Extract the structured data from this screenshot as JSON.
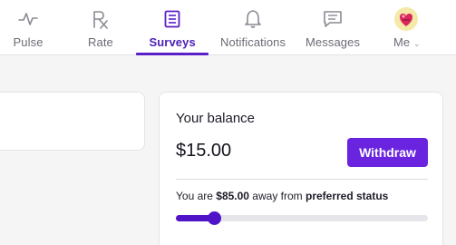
{
  "nav": {
    "items": [
      {
        "label": "Pulse",
        "icon": "pulse-icon"
      },
      {
        "label": "Rate",
        "icon": "rx-icon"
      },
      {
        "label": "Surveys",
        "icon": "survey-list-icon",
        "active": true
      },
      {
        "label": "Notifications",
        "icon": "bell-icon"
      },
      {
        "label": "Messages",
        "icon": "message-icon"
      },
      {
        "label": "Me",
        "icon": "avatar"
      }
    ],
    "active_color": "#5a1fc9"
  },
  "balance": {
    "title": "Your balance",
    "amount": "$15.00",
    "withdraw_label": "Withdraw",
    "status_prefix": "You are ",
    "status_amount": "$85.00",
    "status_middle": " away from ",
    "status_target": "preferred status",
    "progress": 0.15
  },
  "colors": {
    "accent": "#6a24e0",
    "progress": "#4f14c8"
  }
}
